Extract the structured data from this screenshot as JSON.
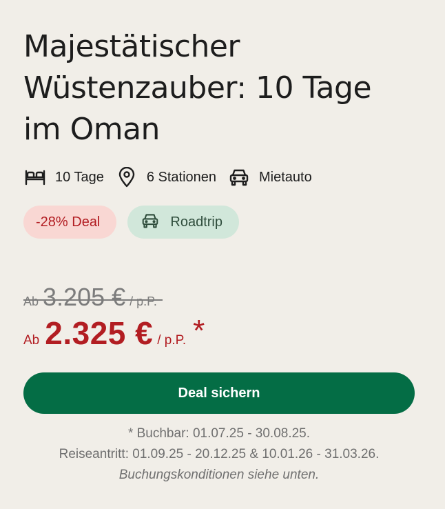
{
  "offer": {
    "title": "Majestätischer Wüstenzauber: 10 Tage im Oman",
    "features": [
      {
        "icon": "bed-icon",
        "label": "10 Tage"
      },
      {
        "icon": "location-pin-icon",
        "label": "6 Stationen"
      },
      {
        "icon": "car-icon",
        "label": "Mietauto"
      }
    ],
    "tags": {
      "deal": "-28% Deal",
      "roadtrip": "Roadtrip"
    },
    "old_price": {
      "prefix": "Ab",
      "amount": "3.205 €",
      "suffix": "/ p.P."
    },
    "new_price": {
      "prefix": "Ab",
      "amount": "2.325 €",
      "suffix": "/ p.P.",
      "footnote_mark": "*"
    },
    "cta_label": "Deal sichern",
    "notes": {
      "booking": "* Buchbar: 01.07.25 - 30.08.25.",
      "travel": "Reiseantritt: 01.09.25 - 20.12.25 & 10.01.26 - 31.03.26.",
      "conditions": "Buchungskonditionen siehe unten."
    }
  },
  "colors": {
    "background": "#f1eee8",
    "accent_red": "#b21d22",
    "cta_green": "#046d45",
    "deal_tag_bg": "#f9d7d3",
    "roadtrip_tag_bg": "#d1e7da"
  }
}
